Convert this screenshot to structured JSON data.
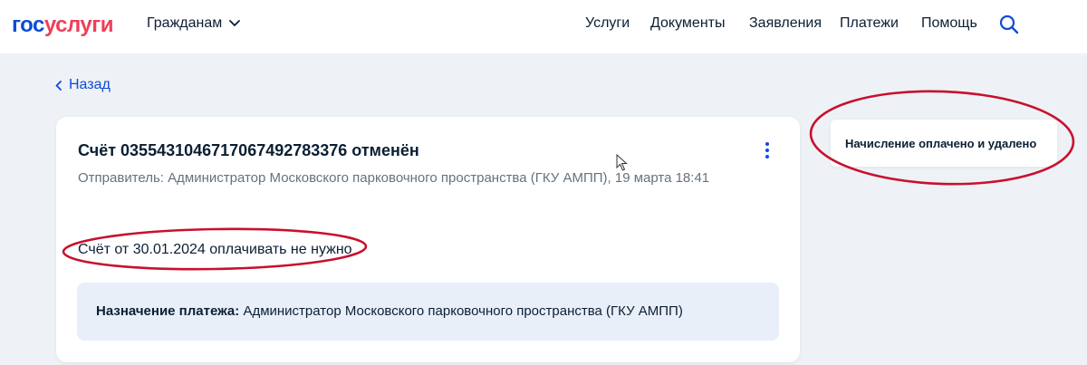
{
  "header": {
    "logo_part1": "гос",
    "logo_part2": "услуги",
    "audience_menu": "Гражданам",
    "nav": [
      "Услуги",
      "Документы",
      "Заявления",
      "Платежи",
      "Помощь"
    ]
  },
  "back_label": "Назад",
  "bill": {
    "title": "Счёт 0355431046717067492783376 отменён",
    "sender": "Отправитель: Администратор Московского парковочного пространства (ГКУ АМПП), 19 марта 18:41",
    "status": "Счёт от 30.01.2024 оплачивать не нужно",
    "purpose_label": "Назначение платежа:",
    "purpose_value": "Администратор Московского парковочного пространства (ГКУ АМПП)"
  },
  "side_status": "Начисление оплачено и удалено",
  "colors": {
    "brand_blue": "#0d4cd3",
    "brand_red": "#ee3f58",
    "annotation_red": "#c8102e",
    "page_bg": "#eef1f6",
    "purpose_bg": "#e9eff9"
  }
}
